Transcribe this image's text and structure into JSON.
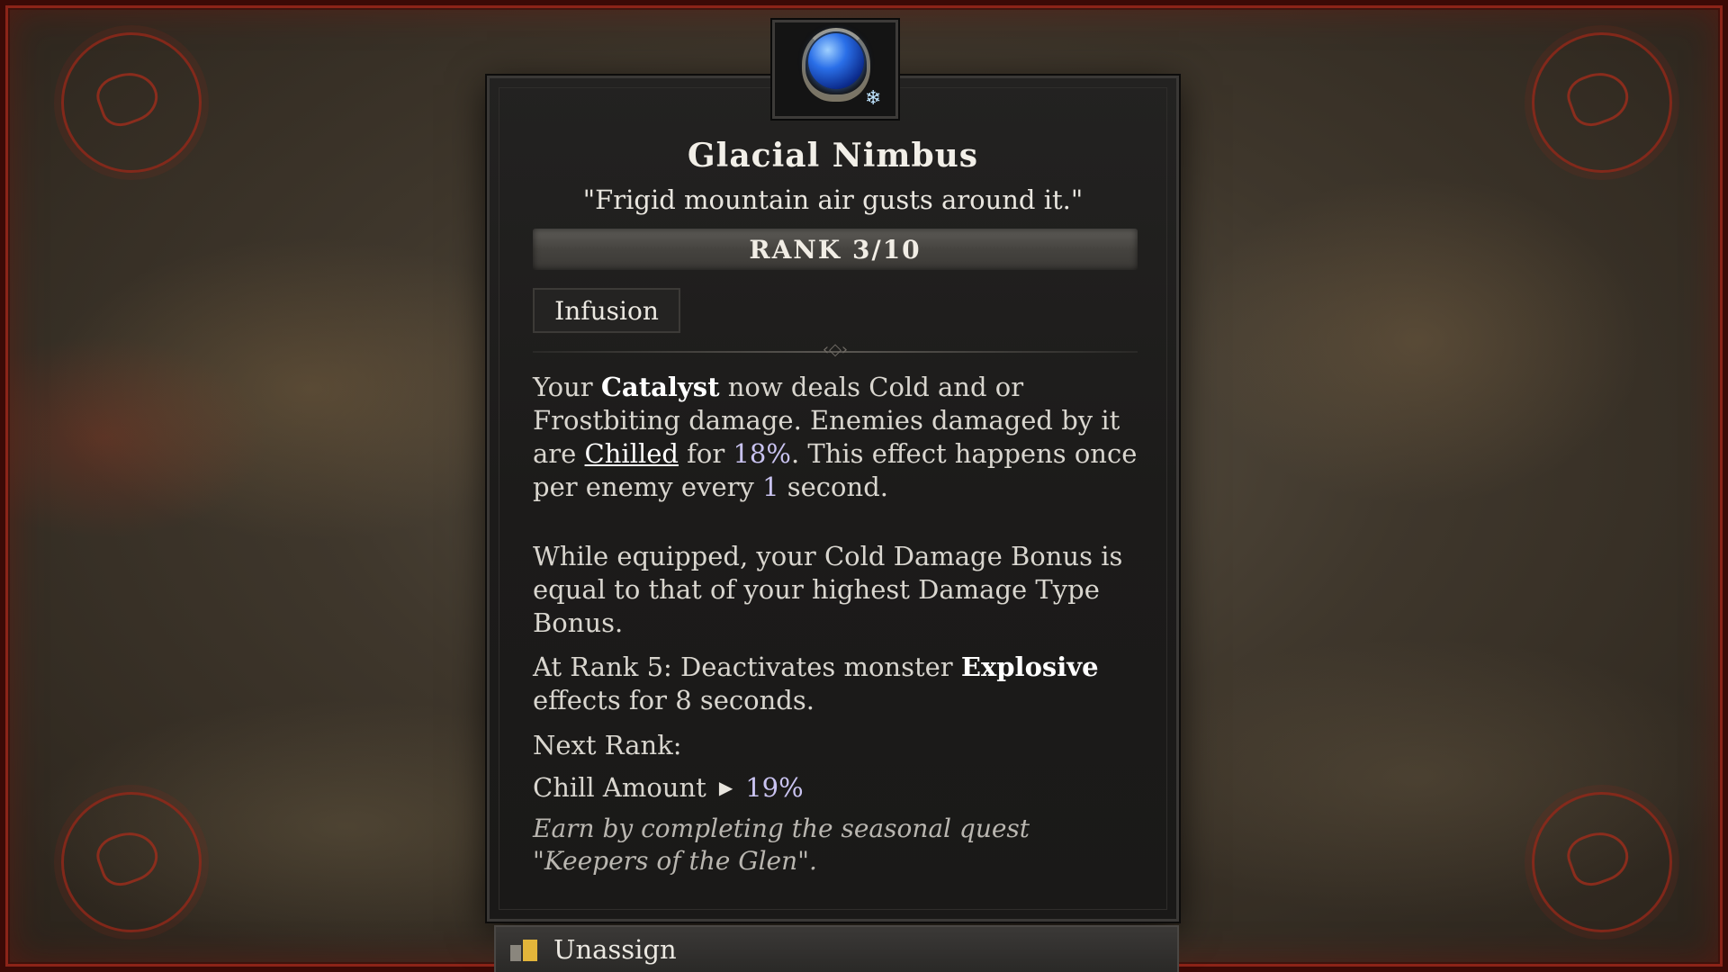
{
  "tooltip": {
    "icon": "glacial-nimbus-gem-icon",
    "element_icon": "snowflake-icon",
    "title": "Glacial Nimbus",
    "flavor": "\"Frigid mountain air gusts around it.\"",
    "rank": "RANK 3/10",
    "tag": "Infusion",
    "desc1": {
      "a": "Your ",
      "catalyst": "Catalyst",
      "b": " now deals Cold and or Frostbiting damage. Enemies damaged by it are ",
      "chilled": "Chilled",
      "c": " for ",
      "pct": "18%",
      "d": ". This effect happens once per enemy every ",
      "secs": "1",
      "e": " second."
    },
    "desc2": "While equipped, your Cold Damage Bonus is equal to that of your highest Damage Type Bonus.",
    "desc3": {
      "a": "At Rank 5: Deactivates monster ",
      "explosive": "Explosive",
      "b": " effects for 8 seconds."
    },
    "next_rank_label": "Next Rank:",
    "next_stat_label": "Chill Amount",
    "next_stat_value": "19%",
    "source": "Earn by completing the seasonal quest \"Keepers of the Glen\"."
  },
  "footer": {
    "unassign_label": "Unassign",
    "unassign_icon": "key-icon"
  },
  "colors": {
    "frame_red": "#8c2418",
    "highlight_number": "#c9c3f0",
    "panel_bg": "#1c1b1a"
  }
}
